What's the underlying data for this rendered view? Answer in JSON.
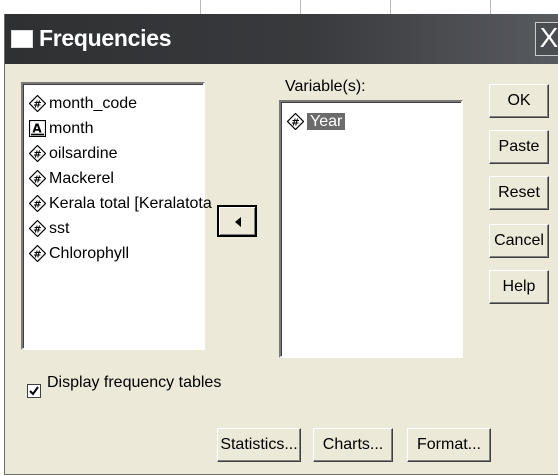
{
  "window": {
    "title": "Frequencies",
    "close_glyph": "X"
  },
  "source_list": {
    "items": [
      {
        "label": "month_code",
        "icon": "numeric-variable-icon"
      },
      {
        "label": "month",
        "icon": "string-variable-icon"
      },
      {
        "label": "oilsardine",
        "icon": "numeric-variable-icon"
      },
      {
        "label": "Mackerel",
        "icon": "numeric-variable-icon"
      },
      {
        "label": "Kerala total [Keralatota",
        "icon": "numeric-variable-icon"
      },
      {
        "label": "sst",
        "icon": "numeric-variable-icon"
      },
      {
        "label": "Chlorophyll",
        "icon": "numeric-variable-icon"
      }
    ]
  },
  "variables": {
    "label": "Variable(s):",
    "items": [
      {
        "label": "Year",
        "icon": "numeric-variable-icon",
        "selected": true
      }
    ]
  },
  "move_button": {
    "icon": "arrow-left-icon"
  },
  "side_buttons": {
    "ok": "OK",
    "paste": "Paste",
    "reset": "Reset",
    "cancel": "Cancel",
    "help": "Help"
  },
  "display_frequency_tables": {
    "label": "Display frequency tables",
    "checked": true
  },
  "bottom_buttons": {
    "statistics": "Statistics...",
    "charts": "Charts...",
    "format": "Format..."
  }
}
